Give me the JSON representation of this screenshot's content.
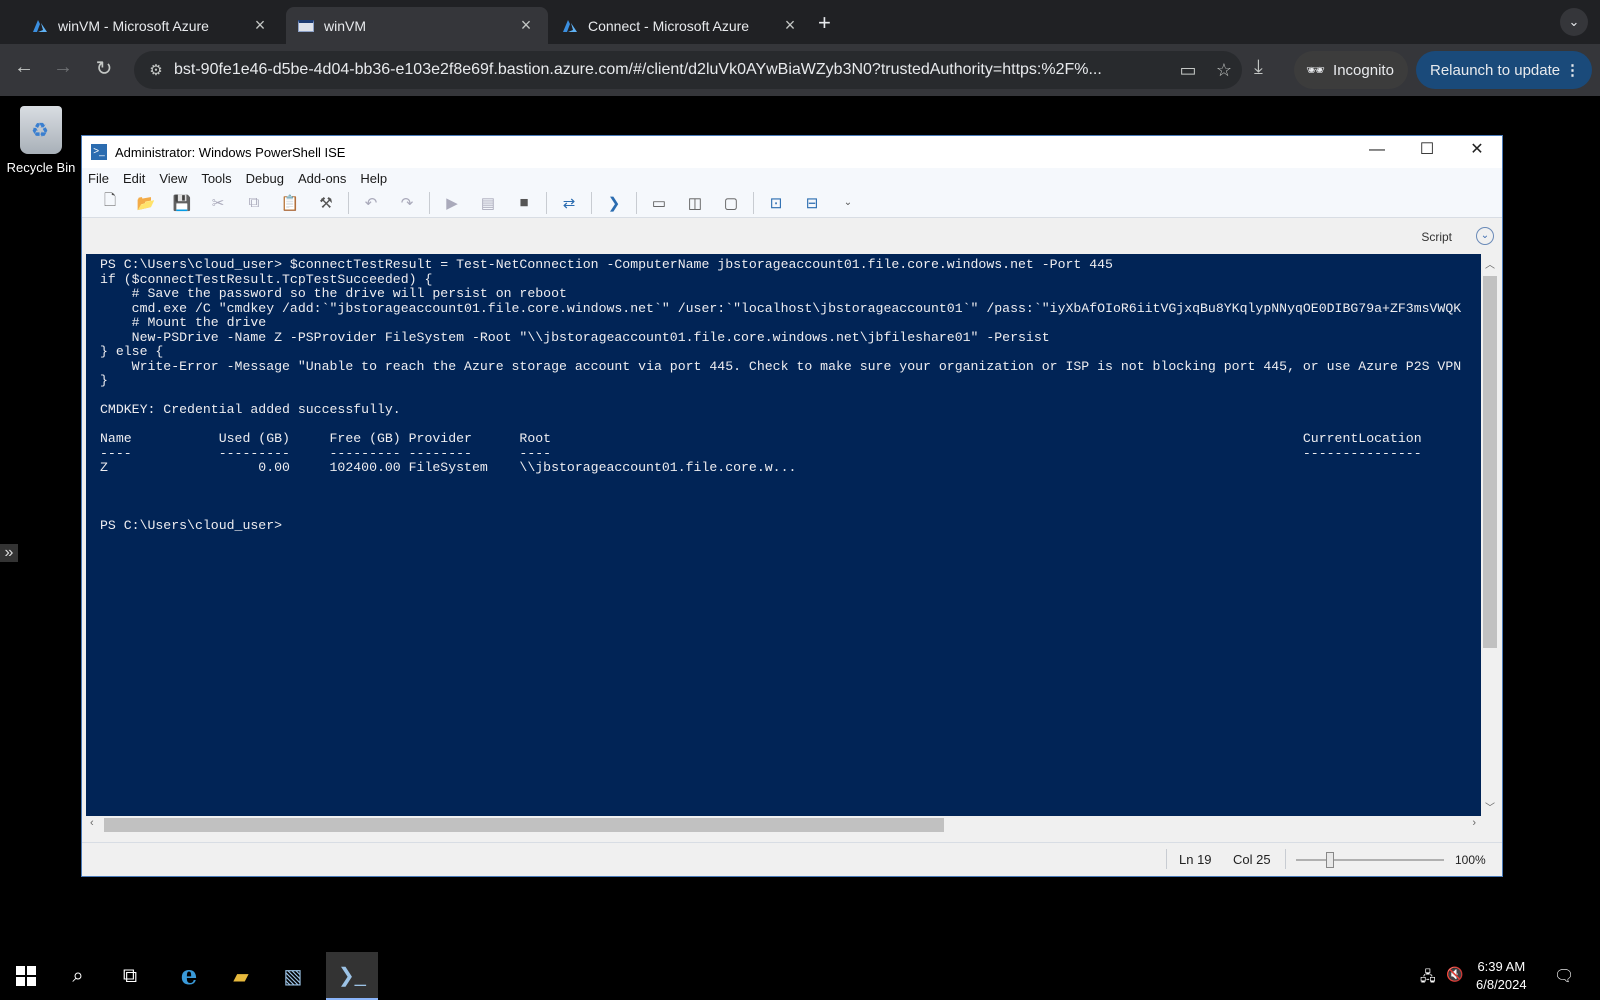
{
  "browser": {
    "tabs": [
      {
        "title": "winVM - Microsoft Azure",
        "icon": "azure-icon",
        "active": false
      },
      {
        "title": "winVM",
        "icon": "vm-icon",
        "active": true
      },
      {
        "title": "Connect - Microsoft Azure",
        "icon": "azure-icon",
        "active": false
      }
    ],
    "url": "bst-90fe1e46-d5be-4d04-bb36-e103e2f8e69f.bastion.azure.com/#/client/d2luVk0AYwBiaWZyb3N0?trustedAuthority=https:%2F%...",
    "incognito_label": "Incognito",
    "relaunch_label": "Relaunch to update"
  },
  "desktop": {
    "recycle_bin_label": "Recycle Bin"
  },
  "ise": {
    "title": "Administrator: Windows PowerShell ISE",
    "menu": [
      "File",
      "Edit",
      "View",
      "Tools",
      "Debug",
      "Add-ons",
      "Help"
    ],
    "script_label": "Script",
    "console_text": "PS C:\\Users\\cloud_user> $connectTestResult = Test-NetConnection -ComputerName jbstorageaccount01.file.core.windows.net -Port 445\nif ($connectTestResult.TcpTestSucceeded) {\n    # Save the password so the drive will persist on reboot\n    cmd.exe /C \"cmdkey /add:`\"jbstorageaccount01.file.core.windows.net`\" /user:`\"localhost\\jbstorageaccount01`\" /pass:`\"iyXbAfOIoR6iitVGjxqBu8YKqlypNNyqOE0DIBG79a+ZF3msVWQK\n    # Mount the drive\n    New-PSDrive -Name Z -PSProvider FileSystem -Root \"\\\\jbstorageaccount01.file.core.windows.net\\jbfileshare01\" -Persist\n} else {\n    Write-Error -Message \"Unable to reach the Azure storage account via port 445. Check to make sure your organization or ISP is not blocking port 445, or use Azure P2S VPN\n}\n\nCMDKEY: Credential added successfully.\n\nName           Used (GB)     Free (GB) Provider      Root                                                                                               CurrentLocation\n----           ---------     --------- --------      ----                                                                                               ---------------\nZ                   0.00     102400.00 FileSystem    \\\\jbstorageaccount01.file.core.w...\n\n\n\nPS C:\\Users\\cloud_user>",
    "status": {
      "line": "Ln 19",
      "col": "Col 25",
      "zoom": "100%",
      "zoom_level_percent": 100
    }
  },
  "taskbar": {
    "clock_time": "6:39 AM",
    "clock_date": "6/8/2024"
  }
}
